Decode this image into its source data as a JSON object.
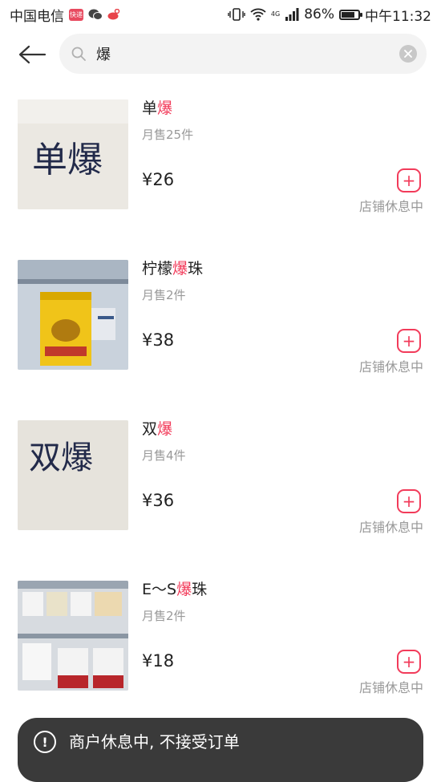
{
  "status_bar": {
    "carrier": "中国电信",
    "app_badge": "快递",
    "battery": "86%",
    "time": "中午11:32",
    "network": "4G",
    "icons": [
      "app-badge-icon",
      "wechat-icon",
      "weibo-icon",
      "vibrate-icon",
      "wifi-icon",
      "signal-icon",
      "battery-icon"
    ]
  },
  "search": {
    "query": "爆",
    "highlight": "爆"
  },
  "products": [
    {
      "name_before": "单",
      "name_highlight": "爆",
      "name_after": "",
      "sales": "月售25件",
      "price": "¥26",
      "status": "店铺休息中",
      "add": "+",
      "thumb_text": "单爆"
    },
    {
      "name_before": "柠檬",
      "name_highlight": "爆",
      "name_after": "珠",
      "sales": "月售2件",
      "price": "¥38",
      "status": "店铺休息中",
      "add": "+",
      "thumb_text": ""
    },
    {
      "name_before": "双",
      "name_highlight": "爆",
      "name_after": "",
      "sales": "月售4件",
      "price": "¥36",
      "status": "店铺休息中",
      "add": "+",
      "thumb_text": "双爆"
    },
    {
      "name_before": "E～S",
      "name_highlight": "爆",
      "name_after": "珠",
      "sales": "月售2件",
      "price": "¥18",
      "status": "店铺休息中",
      "add": "+",
      "thumb_text": ""
    }
  ],
  "notice": {
    "icon": "!",
    "text": "商户休息中, 不接受订单"
  },
  "colors": {
    "accent": "#f23b5a",
    "muted": "#999999",
    "notice_bg": "#3a3a3a"
  }
}
